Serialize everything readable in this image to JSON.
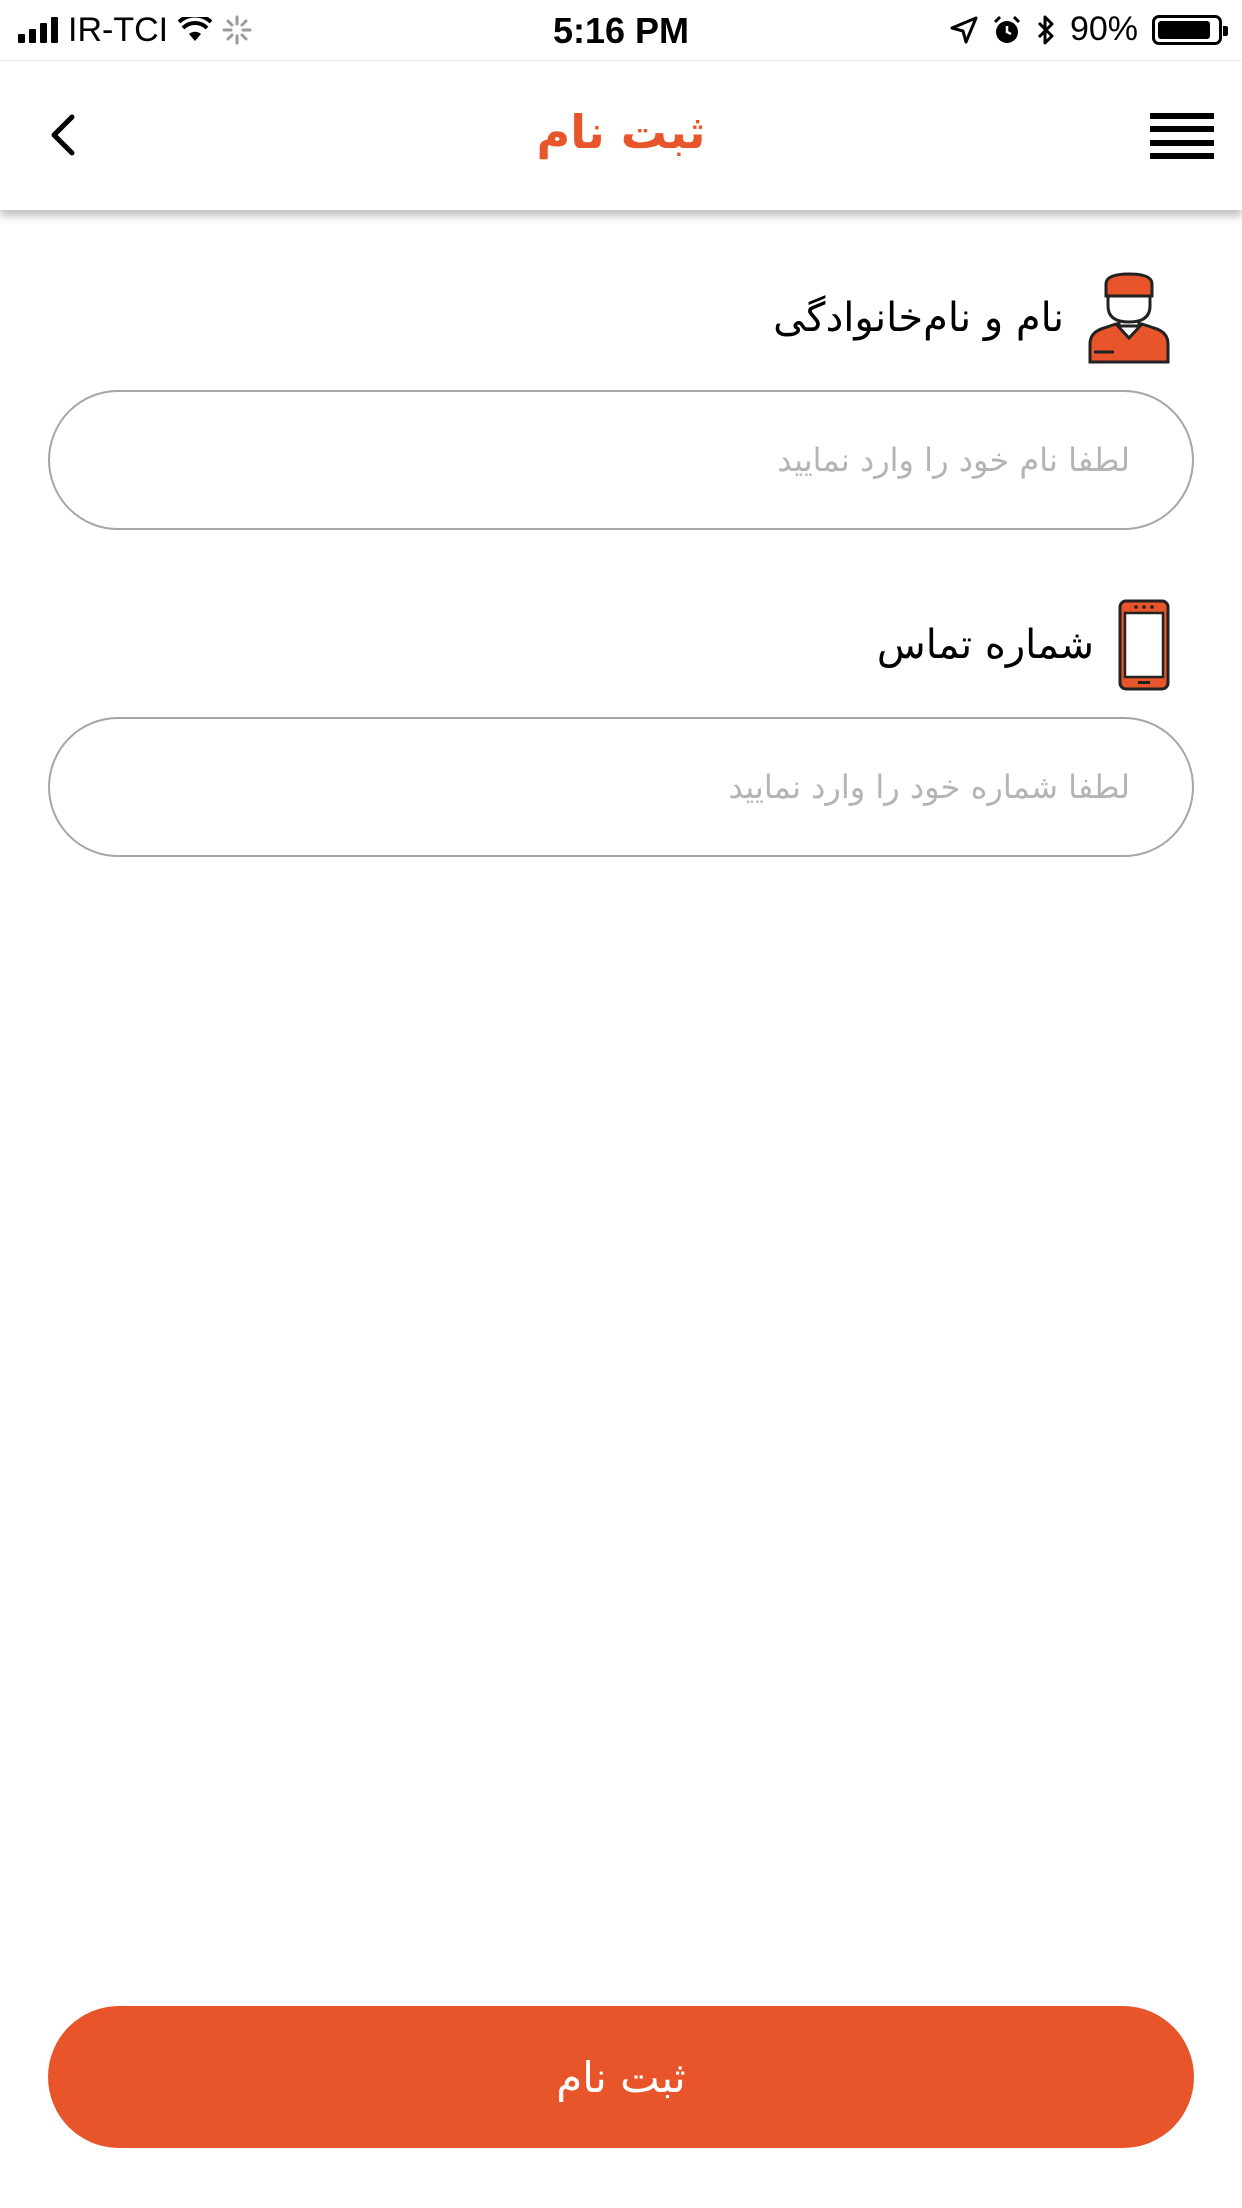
{
  "status_bar": {
    "carrier": "IR-TCI",
    "time": "5:16 PM",
    "battery": "90%",
    "icons": [
      "signal-icon",
      "wifi-icon",
      "loading-icon",
      "location-icon",
      "alarm-icon",
      "bluetooth-icon",
      "battery-icon"
    ]
  },
  "nav": {
    "title": "ثبت نام",
    "back_icon": "chevron-left-icon",
    "menu_icon": "hamburger-menu-icon"
  },
  "form": {
    "name": {
      "label": "نام و نام‌خانوادگی",
      "placeholder": "لطفا نام خود را وارد نمایید",
      "value": "",
      "icon": "user-avatar-icon"
    },
    "phone": {
      "label": "شماره تماس",
      "placeholder": "لطفا شماره خود را وارد نمایید",
      "value": "",
      "icon": "mobile-phone-icon"
    }
  },
  "submit": {
    "label": "ثبت نام"
  },
  "colors": {
    "accent": "#E8552A",
    "input_border": "#A6A6A6",
    "placeholder": "#B4B4B4"
  }
}
